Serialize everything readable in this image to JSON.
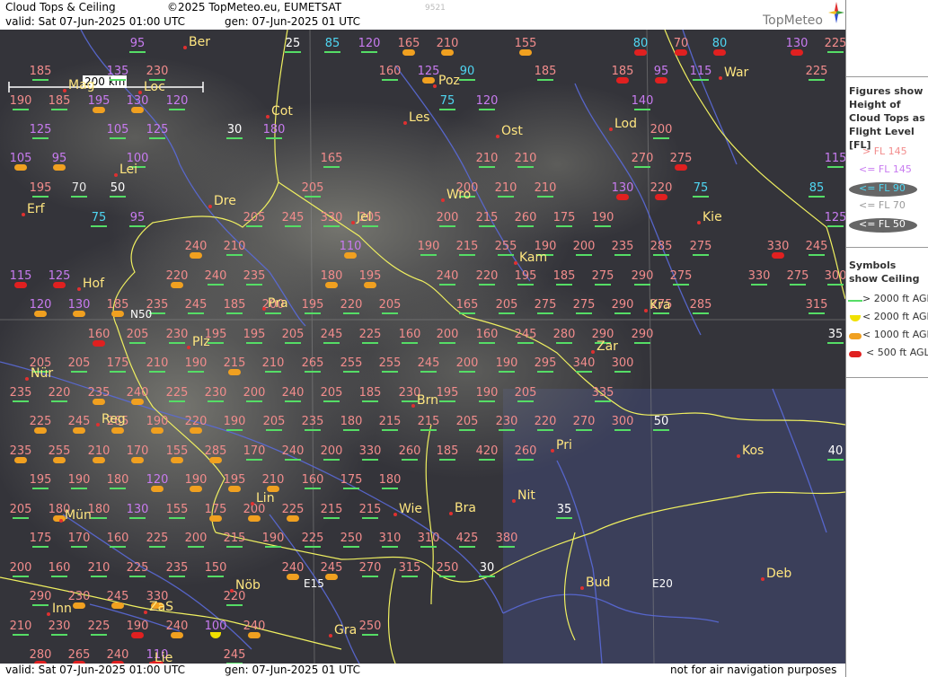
{
  "header": {
    "title": "Cloud Tops & Ceiling",
    "copyright": "©2025 TopMeteo.eu, EUMETSAT",
    "valid": "valid:  Sat  07-Jun-2025  01:00 UTC",
    "generated": "gen: 07-Jun-2025 01 UTC",
    "code": "9521",
    "brand": "TopMeteo"
  },
  "footer": {
    "valid": "valid:  Sat  07-Jun-2025  01:00 UTC",
    "generated": "gen: 07-Jun-2025 01 UTC",
    "disclaimer": "not for air navigation purposes"
  },
  "scale": "200 km",
  "legend": {
    "figures_title": "Figures show Height of Cloud Tops as Flight Level  [FL]",
    "fl_items": [
      "> FL 145",
      "<= FL 145",
      "<= FL 90",
      "<= FL 70",
      "<= FL 50"
    ],
    "symbols_title": "Symbols show Ceiling",
    "ceiling_items": [
      "> 2000 ft AGL",
      "< 2000 ft AGL",
      "< 1000 ft AGL",
      "< 500 ft AGL"
    ]
  },
  "colors": {
    "map_bg": "#2f2f33",
    "border_yellow": "#f0f060",
    "river_blue": "#5a6ad8",
    "fl_high": "#f28c8c",
    "fl_145": "#c87bf0",
    "fl_90": "#4fd6f2",
    "ceiling_green": "#55dd66",
    "ceiling_orange": "#f0a020",
    "ceiling_red": "#e02020",
    "ceiling_yellow": "#f0e000"
  },
  "cities": [
    "Ber",
    "Mag",
    "Loc",
    "Cot",
    "Poz",
    "War",
    "Les",
    "Ost",
    "Lod",
    "Lei",
    "Dre",
    "Wro",
    "Erf",
    "Jel",
    "Kie",
    "Kam",
    "Hof",
    "Pra",
    "Kra",
    "Plz",
    "Zar",
    "Nür",
    "Brn",
    "Reg",
    "Pri",
    "Kos",
    "Lin",
    "Nit",
    "Mün",
    "Wie",
    "Bra",
    "Inn",
    "ZaS",
    "Nöb",
    "Bud",
    "Deb",
    "Gra",
    "Lie"
  ],
  "grid_labels": [
    "N50",
    "E15",
    "E20"
  ],
  "values": [
    {
      "v": "95",
      "c": "fl-145"
    },
    {
      "v": "25",
      "c": "fl-50"
    },
    {
      "v": "85",
      "c": "fl-90"
    },
    {
      "v": "120",
      "c": "fl-145"
    },
    {
      "v": "165",
      "c": "fl-hi",
      "s": "org"
    },
    {
      "v": "210",
      "c": "fl-hi",
      "s": "org"
    },
    {
      "v": "155",
      "c": "fl-hi",
      "s": "org"
    },
    {
      "v": "80",
      "c": "fl-90",
      "s": "red"
    },
    {
      "v": "70",
      "c": "fl-hi",
      "s": "red"
    },
    {
      "v": "80",
      "c": "fl-90",
      "s": "red"
    },
    {
      "v": "130",
      "c": "fl-145",
      "s": "red"
    },
    {
      "v": "225",
      "c": "fl-hi"
    },
    {
      "v": "185",
      "c": "fl-hi"
    },
    {
      "v": "135",
      "c": "fl-145"
    },
    {
      "v": "230",
      "c": "fl-hi"
    },
    {
      "v": "160",
      "c": "fl-hi"
    },
    {
      "v": "125",
      "c": "fl-145",
      "s": "org"
    },
    {
      "v": "90",
      "c": "fl-90"
    },
    {
      "v": "185",
      "c": "fl-hi"
    },
    {
      "v": "185",
      "c": "fl-hi",
      "s": "red"
    },
    {
      "v": "95",
      "c": "fl-145",
      "s": "red"
    },
    {
      "v": "115",
      "c": "fl-145"
    },
    {
      "v": "225",
      "c": "fl-hi"
    },
    {
      "v": "190",
      "c": "fl-hi"
    },
    {
      "v": "185",
      "c": "fl-hi"
    },
    {
      "v": "195",
      "c": "fl-145",
      "s": "org"
    },
    {
      "v": "130",
      "c": "fl-145",
      "s": "org"
    },
    {
      "v": "120",
      "c": "fl-145"
    },
    {
      "v": "75",
      "c": "fl-90"
    },
    {
      "v": "120",
      "c": "fl-145"
    },
    {
      "v": "140",
      "c": "fl-145"
    },
    {
      "v": "125",
      "c": "fl-145"
    },
    {
      "v": "105",
      "c": "fl-145"
    },
    {
      "v": "125",
      "c": "fl-145"
    },
    {
      "v": "30",
      "c": "fl-50"
    },
    {
      "v": "180",
      "c": "fl-145"
    },
    {
      "v": "200",
      "c": "fl-hi"
    },
    {
      "v": "105",
      "c": "fl-145",
      "s": "org"
    },
    {
      "v": "95",
      "c": "fl-145",
      "s": "org"
    },
    {
      "v": "100",
      "c": "fl-145"
    },
    {
      "v": "165",
      "c": "fl-hi"
    },
    {
      "v": "210",
      "c": "fl-hi"
    },
    {
      "v": "210",
      "c": "fl-hi"
    },
    {
      "v": "270",
      "c": "fl-hi"
    },
    {
      "v": "275",
      "c": "fl-hi",
      "s": "red"
    },
    {
      "v": "115",
      "c": "fl-145"
    },
    {
      "v": "195",
      "c": "fl-hi"
    },
    {
      "v": "70",
      "c": "fl-70"
    },
    {
      "v": "50",
      "c": "fl-50"
    },
    {
      "v": "205",
      "c": "fl-hi"
    },
    {
      "v": "200",
      "c": "fl-hi"
    },
    {
      "v": "210",
      "c": "fl-hi"
    },
    {
      "v": "210",
      "c": "fl-hi"
    },
    {
      "v": "130",
      "c": "fl-145",
      "s": "red"
    },
    {
      "v": "220",
      "c": "fl-hi",
      "s": "red"
    },
    {
      "v": "75",
      "c": "fl-90"
    },
    {
      "v": "85",
      "c": "fl-90"
    },
    {
      "v": "75",
      "c": "fl-90"
    },
    {
      "v": "95",
      "c": "fl-145"
    },
    {
      "v": "205",
      "c": "fl-hi"
    },
    {
      "v": "245",
      "c": "fl-hi"
    },
    {
      "v": "330",
      "c": "fl-hi"
    },
    {
      "v": "205",
      "c": "fl-hi"
    },
    {
      "v": "200",
      "c": "fl-hi"
    },
    {
      "v": "215",
      "c": "fl-hi"
    },
    {
      "v": "260",
      "c": "fl-hi"
    },
    {
      "v": "175",
      "c": "fl-hi"
    },
    {
      "v": "190",
      "c": "fl-hi"
    },
    {
      "v": "125",
      "c": "fl-145"
    },
    {
      "v": "240",
      "c": "fl-hi",
      "s": "org"
    },
    {
      "v": "210",
      "c": "fl-hi"
    },
    {
      "v": "110",
      "c": "fl-145",
      "s": "org"
    },
    {
      "v": "190",
      "c": "fl-hi"
    },
    {
      "v": "215",
      "c": "fl-hi"
    },
    {
      "v": "255",
      "c": "fl-hi"
    },
    {
      "v": "190",
      "c": "fl-hi"
    },
    {
      "v": "200",
      "c": "fl-hi"
    },
    {
      "v": "235",
      "c": "fl-hi"
    },
    {
      "v": "285",
      "c": "fl-hi"
    },
    {
      "v": "275",
      "c": "fl-hi"
    },
    {
      "v": "330",
      "c": "fl-hi",
      "s": "red"
    },
    {
      "v": "245",
      "c": "fl-hi"
    },
    {
      "v": "115",
      "c": "fl-145",
      "s": "red"
    },
    {
      "v": "125",
      "c": "fl-145",
      "s": "red"
    },
    {
      "v": "220",
      "c": "fl-hi",
      "s": "org"
    },
    {
      "v": "240",
      "c": "fl-hi"
    },
    {
      "v": "235",
      "c": "fl-hi"
    },
    {
      "v": "180",
      "c": "fl-hi",
      "s": "org"
    },
    {
      "v": "195",
      "c": "fl-hi",
      "s": "org"
    },
    {
      "v": "240",
      "c": "fl-hi"
    },
    {
      "v": "220",
      "c": "fl-hi"
    },
    {
      "v": "195",
      "c": "fl-hi"
    },
    {
      "v": "185",
      "c": "fl-hi"
    },
    {
      "v": "275",
      "c": "fl-hi"
    },
    {
      "v": "290",
      "c": "fl-hi"
    },
    {
      "v": "275",
      "c": "fl-hi"
    },
    {
      "v": "330",
      "c": "fl-hi"
    },
    {
      "v": "275",
      "c": "fl-hi"
    },
    {
      "v": "300",
      "c": "fl-hi"
    },
    {
      "v": "120",
      "c": "fl-145",
      "s": "org"
    },
    {
      "v": "130",
      "c": "fl-145",
      "s": "org"
    },
    {
      "v": "185",
      "c": "fl-hi",
      "s": "org"
    },
    {
      "v": "235",
      "c": "fl-hi"
    },
    {
      "v": "245",
      "c": "fl-hi"
    },
    {
      "v": "185",
      "c": "fl-hi"
    },
    {
      "v": "200",
      "c": "fl-hi"
    },
    {
      "v": "195",
      "c": "fl-hi"
    },
    {
      "v": "220",
      "c": "fl-hi"
    },
    {
      "v": "205",
      "c": "fl-hi"
    },
    {
      "v": "165",
      "c": "fl-hi"
    },
    {
      "v": "205",
      "c": "fl-hi"
    },
    {
      "v": "275",
      "c": "fl-hi"
    },
    {
      "v": "275",
      "c": "fl-hi"
    },
    {
      "v": "290",
      "c": "fl-hi"
    },
    {
      "v": "275",
      "c": "fl-hi"
    },
    {
      "v": "285",
      "c": "fl-hi"
    },
    {
      "v": "315",
      "c": "fl-hi"
    },
    {
      "v": "160",
      "c": "fl-hi",
      "s": "red"
    },
    {
      "v": "205",
      "c": "fl-hi"
    },
    {
      "v": "230",
      "c": "fl-hi"
    },
    {
      "v": "195",
      "c": "fl-hi"
    },
    {
      "v": "195",
      "c": "fl-hi"
    },
    {
      "v": "205",
      "c": "fl-hi"
    },
    {
      "v": "245",
      "c": "fl-hi"
    },
    {
      "v": "225",
      "c": "fl-hi"
    },
    {
      "v": "160",
      "c": "fl-hi"
    },
    {
      "v": "200",
      "c": "fl-hi"
    },
    {
      "v": "160",
      "c": "fl-hi"
    },
    {
      "v": "245",
      "c": "fl-hi"
    },
    {
      "v": "280",
      "c": "fl-hi"
    },
    {
      "v": "290",
      "c": "fl-hi"
    },
    {
      "v": "290",
      "c": "fl-hi"
    },
    {
      "v": "35",
      "c": "fl-50"
    },
    {
      "v": "205",
      "c": "fl-hi"
    },
    {
      "v": "205",
      "c": "fl-hi"
    },
    {
      "v": "175",
      "c": "fl-hi"
    },
    {
      "v": "210",
      "c": "fl-hi"
    },
    {
      "v": "190",
      "c": "fl-hi"
    },
    {
      "v": "215",
      "c": "fl-hi",
      "s": "org"
    },
    {
      "v": "210",
      "c": "fl-hi"
    },
    {
      "v": "265",
      "c": "fl-hi"
    },
    {
      "v": "255",
      "c": "fl-hi"
    },
    {
      "v": "255",
      "c": "fl-hi"
    },
    {
      "v": "245",
      "c": "fl-hi"
    },
    {
      "v": "200",
      "c": "fl-hi"
    },
    {
      "v": "190",
      "c": "fl-hi"
    },
    {
      "v": "295",
      "c": "fl-hi"
    },
    {
      "v": "340",
      "c": "fl-hi"
    },
    {
      "v": "300",
      "c": "fl-hi"
    },
    {
      "v": "235",
      "c": "fl-hi"
    },
    {
      "v": "220",
      "c": "fl-hi"
    },
    {
      "v": "235",
      "c": "fl-hi",
      "s": "org"
    },
    {
      "v": "240",
      "c": "fl-hi",
      "s": "org"
    },
    {
      "v": "225",
      "c": "fl-hi"
    },
    {
      "v": "230",
      "c": "fl-hi"
    },
    {
      "v": "200",
      "c": "fl-hi"
    },
    {
      "v": "240",
      "c": "fl-hi"
    },
    {
      "v": "205",
      "c": "fl-hi"
    },
    {
      "v": "185",
      "c": "fl-hi"
    },
    {
      "v": "230",
      "c": "fl-hi"
    },
    {
      "v": "195",
      "c": "fl-hi"
    },
    {
      "v": "190",
      "c": "fl-hi"
    },
    {
      "v": "205",
      "c": "fl-hi"
    },
    {
      "v": "335",
      "c": "fl-hi"
    },
    {
      "v": "225",
      "c": "fl-hi",
      "s": "org"
    },
    {
      "v": "245",
      "c": "fl-hi",
      "s": "org"
    },
    {
      "v": "265",
      "c": "fl-hi",
      "s": "org"
    },
    {
      "v": "190",
      "c": "fl-hi",
      "s": "org"
    },
    {
      "v": "220",
      "c": "fl-hi",
      "s": "org"
    },
    {
      "v": "190",
      "c": "fl-hi"
    },
    {
      "v": "205",
      "c": "fl-hi"
    },
    {
      "v": "235",
      "c": "fl-hi"
    },
    {
      "v": "180",
      "c": "fl-hi"
    },
    {
      "v": "215",
      "c": "fl-hi"
    },
    {
      "v": "215",
      "c": "fl-hi"
    },
    {
      "v": "205",
      "c": "fl-hi"
    },
    {
      "v": "230",
      "c": "fl-hi"
    },
    {
      "v": "220",
      "c": "fl-hi"
    },
    {
      "v": "270",
      "c": "fl-hi"
    },
    {
      "v": "300",
      "c": "fl-hi"
    },
    {
      "v": "50",
      "c": "fl-50"
    },
    {
      "v": "235",
      "c": "fl-hi",
      "s": "org"
    },
    {
      "v": "255",
      "c": "fl-hi",
      "s": "org"
    },
    {
      "v": "210",
      "c": "fl-hi",
      "s": "org"
    },
    {
      "v": "170",
      "c": "fl-hi",
      "s": "org"
    },
    {
      "v": "155",
      "c": "fl-hi",
      "s": "org"
    },
    {
      "v": "285",
      "c": "fl-hi",
      "s": "org"
    },
    {
      "v": "170",
      "c": "fl-hi"
    },
    {
      "v": "240",
      "c": "fl-hi"
    },
    {
      "v": "200",
      "c": "fl-hi"
    },
    {
      "v": "330",
      "c": "fl-hi"
    },
    {
      "v": "260",
      "c": "fl-hi"
    },
    {
      "v": "185",
      "c": "fl-hi"
    },
    {
      "v": "420",
      "c": "fl-hi"
    },
    {
      "v": "260",
      "c": "fl-hi"
    },
    {
      "v": "40",
      "c": "fl-50"
    },
    {
      "v": "195",
      "c": "fl-hi"
    },
    {
      "v": "190",
      "c": "fl-hi"
    },
    {
      "v": "180",
      "c": "fl-hi"
    },
    {
      "v": "120",
      "c": "fl-145",
      "s": "org"
    },
    {
      "v": "190",
      "c": "fl-hi",
      "s": "org"
    },
    {
      "v": "195",
      "c": "fl-hi",
      "s": "org"
    },
    {
      "v": "210",
      "c": "fl-hi",
      "s": "org"
    },
    {
      "v": "160",
      "c": "fl-hi"
    },
    {
      "v": "175",
      "c": "fl-hi"
    },
    {
      "v": "180",
      "c": "fl-hi"
    },
    {
      "v": "205",
      "c": "fl-hi"
    },
    {
      "v": "180",
      "c": "fl-hi",
      "s": "org"
    },
    {
      "v": "180",
      "c": "fl-hi"
    },
    {
      "v": "130",
      "c": "fl-145"
    },
    {
      "v": "155",
      "c": "fl-hi"
    },
    {
      "v": "175",
      "c": "fl-hi",
      "s": "org"
    },
    {
      "v": "200",
      "c": "fl-hi",
      "s": "org"
    },
    {
      "v": "225",
      "c": "fl-hi",
      "s": "org"
    },
    {
      "v": "215",
      "c": "fl-hi"
    },
    {
      "v": "215",
      "c": "fl-hi"
    },
    {
      "v": "35",
      "c": "fl-50"
    },
    {
      "v": "175",
      "c": "fl-hi"
    },
    {
      "v": "170",
      "c": "fl-hi"
    },
    {
      "v": "160",
      "c": "fl-hi"
    },
    {
      "v": "225",
      "c": "fl-hi"
    },
    {
      "v": "200",
      "c": "fl-hi"
    },
    {
      "v": "215",
      "c": "fl-hi"
    },
    {
      "v": "190",
      "c": "fl-hi"
    },
    {
      "v": "225",
      "c": "fl-hi"
    },
    {
      "v": "250",
      "c": "fl-hi"
    },
    {
      "v": "310",
      "c": "fl-hi"
    },
    {
      "v": "310",
      "c": "fl-hi"
    },
    {
      "v": "425",
      "c": "fl-hi"
    },
    {
      "v": "380",
      "c": "fl-hi"
    },
    {
      "v": "200",
      "c": "fl-hi"
    },
    {
      "v": "160",
      "c": "fl-hi"
    },
    {
      "v": "210",
      "c": "fl-hi"
    },
    {
      "v": "225",
      "c": "fl-hi"
    },
    {
      "v": "235",
      "c": "fl-hi"
    },
    {
      "v": "150",
      "c": "fl-hi"
    },
    {
      "v": "240",
      "c": "fl-hi",
      "s": "org"
    },
    {
      "v": "245",
      "c": "fl-hi",
      "s": "org"
    },
    {
      "v": "270",
      "c": "fl-hi"
    },
    {
      "v": "315",
      "c": "fl-hi"
    },
    {
      "v": "250",
      "c": "fl-hi"
    },
    {
      "v": "30",
      "c": "fl-50"
    },
    {
      "v": "290",
      "c": "fl-hi"
    },
    {
      "v": "230",
      "c": "fl-hi",
      "s": "org"
    },
    {
      "v": "245",
      "c": "fl-hi",
      "s": "org"
    },
    {
      "v": "330",
      "c": "fl-hi",
      "s": "org"
    },
    {
      "v": "220",
      "c": "fl-hi"
    },
    {
      "v": "210",
      "c": "fl-hi"
    },
    {
      "v": "230",
      "c": "fl-hi"
    },
    {
      "v": "225",
      "c": "fl-hi"
    },
    {
      "v": "190",
      "c": "fl-hi",
      "s": "red"
    },
    {
      "v": "240",
      "c": "fl-hi",
      "s": "org"
    },
    {
      "v": "100",
      "c": "fl-145",
      "s": "yel"
    },
    {
      "v": "240",
      "c": "fl-hi",
      "s": "org"
    },
    {
      "v": "250",
      "c": "fl-hi"
    },
    {
      "v": "280",
      "c": "fl-hi",
      "s": "red"
    },
    {
      "v": "265",
      "c": "fl-hi",
      "s": "red"
    },
    {
      "v": "240",
      "c": "fl-hi",
      "s": "red"
    },
    {
      "v": "110",
      "c": "fl-145",
      "s": "red"
    },
    {
      "v": "245",
      "c": "fl-hi"
    }
  ]
}
